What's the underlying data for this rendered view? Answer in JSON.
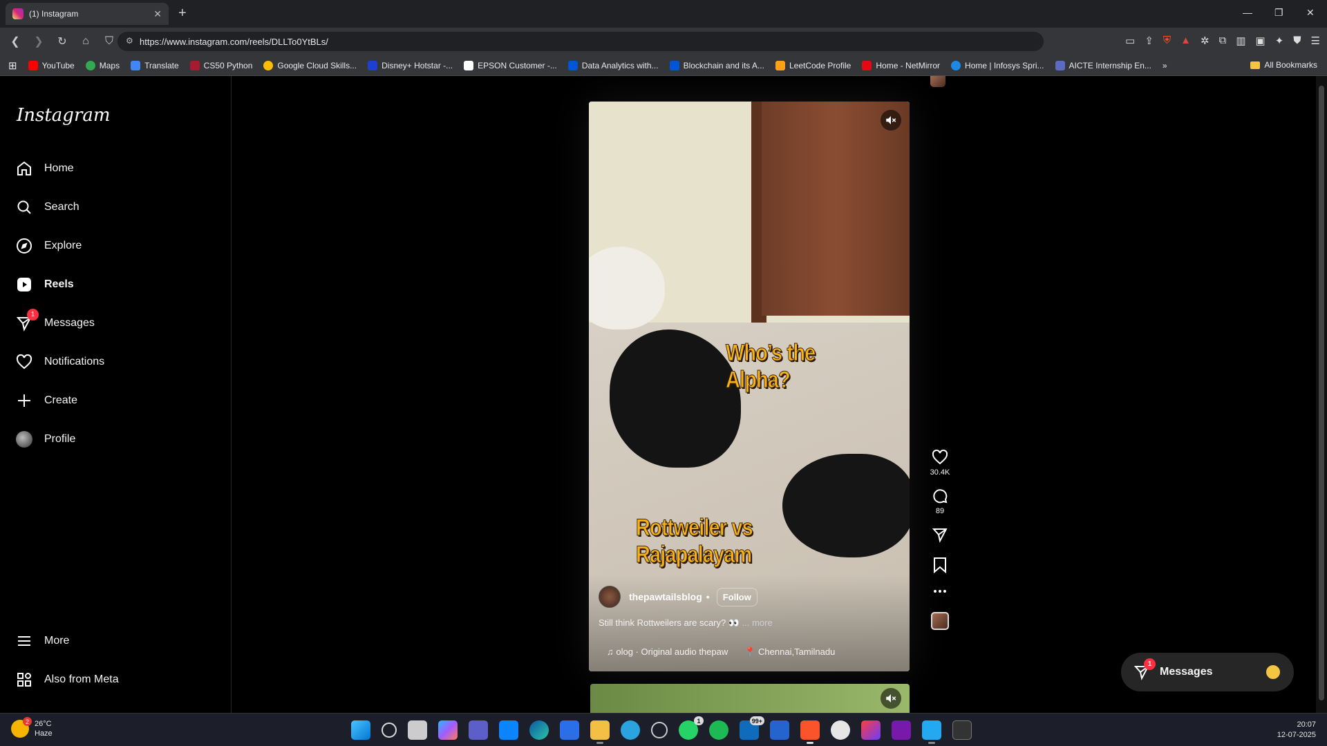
{
  "browser": {
    "tab_title": "(1) Instagram",
    "url": "https://www.instagram.com/reels/DLLTo0YtBLs/",
    "bookmarks": [
      "YouTube",
      "Maps",
      "Translate",
      "CS50 Python",
      "Google Cloud Skills...",
      "Disney+ Hotstar -...",
      "EPSON Customer -...",
      "Data Analytics with...",
      "Blockchain and its A...",
      "LeetCode Profile",
      "Home - NetMirror",
      "Home | Infosys Spri...",
      "AICTE Internship En..."
    ],
    "all_bookmarks": "All Bookmarks",
    "extension_badge": "1"
  },
  "sidebar": {
    "logo": "Instagram",
    "items": [
      {
        "label": "Home",
        "icon": "home-icon"
      },
      {
        "label": "Search",
        "icon": "search-icon"
      },
      {
        "label": "Explore",
        "icon": "compass-icon"
      },
      {
        "label": "Reels",
        "icon": "reels-icon"
      },
      {
        "label": "Messages",
        "icon": "messenger-icon",
        "badge": "1"
      },
      {
        "label": "Notifications",
        "icon": "heart-icon"
      },
      {
        "label": "Create",
        "icon": "plus-icon"
      },
      {
        "label": "Profile",
        "icon": "avatar"
      }
    ],
    "more": "More",
    "meta": "Also from Meta"
  },
  "reel": {
    "overlay_top": "Who’s the Alpha?",
    "overlay_bottom": "Rottweiler vs Rajapalayam",
    "author": "thepawtailsblog",
    "separator": "•",
    "follow": "Follow",
    "caption": "Still think Rottweilers are scary? 👀",
    "more": "... more",
    "audio": "♫ olog · Original audio  thepaw",
    "location": "📍 Chennai,Tamilnadu"
  },
  "actions": {
    "likes": "30.4K",
    "comments": "89"
  },
  "messages_pill": {
    "label": "Messages",
    "badge": "1"
  },
  "taskbar": {
    "temp": "26°C",
    "condition": "Haze",
    "weather_badge": "2",
    "whatsapp_badge": "1",
    "mail_badge": "99+",
    "time": "20:07",
    "date": "12-07-2025"
  },
  "colors": {
    "overlay_text": "#f7b21a",
    "badge": "#ff3040",
    "background": "#000000"
  }
}
